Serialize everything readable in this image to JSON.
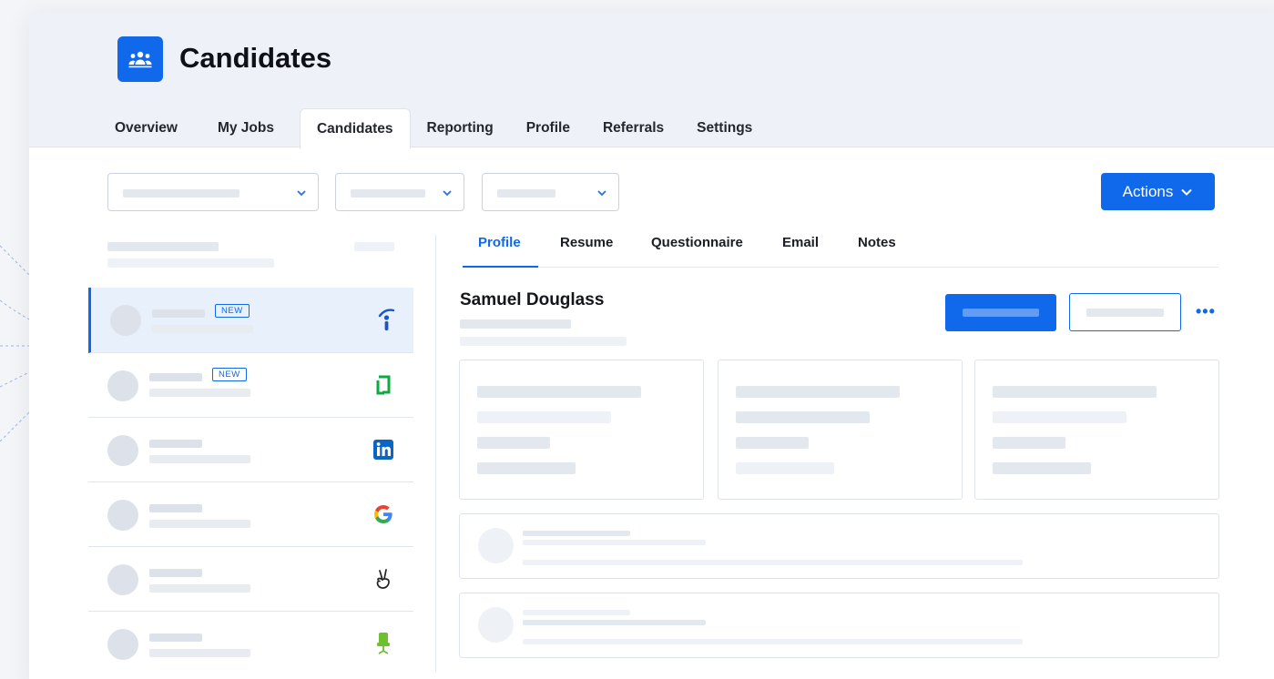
{
  "app": {
    "title": "Candidates",
    "accent_color": "#1068eb",
    "icon": "people-group-icon"
  },
  "nav": {
    "tabs": [
      {
        "label": "Overview",
        "active": false
      },
      {
        "label": "My Jobs",
        "active": false
      },
      {
        "label": "Candidates",
        "active": true
      },
      {
        "label": "Reporting",
        "active": false
      },
      {
        "label": "Profile",
        "active": false
      },
      {
        "label": "Referrals",
        "active": false
      },
      {
        "label": "Settings",
        "active": false
      }
    ]
  },
  "toolbar": {
    "actions_label": "Actions",
    "filters": [
      {
        "icon": "chevron-down-icon"
      },
      {
        "icon": "chevron-down-icon"
      },
      {
        "icon": "chevron-down-icon"
      }
    ]
  },
  "candidate_list": {
    "rows": [
      {
        "badge": "NEW",
        "source_icon": "indeed-icon",
        "selected": true
      },
      {
        "badge": "NEW",
        "source_icon": "glassdoor-icon",
        "selected": false
      },
      {
        "badge": "",
        "source_icon": "linkedin-icon",
        "selected": false
      },
      {
        "badge": "",
        "source_icon": "google-icon",
        "selected": false
      },
      {
        "badge": "",
        "source_icon": "angellist-icon",
        "selected": false
      },
      {
        "badge": "",
        "source_icon": "ziprecruiter-icon",
        "selected": false
      }
    ]
  },
  "profile": {
    "tabs": [
      {
        "label": "Profile",
        "active": true
      },
      {
        "label": "Resume",
        "active": false
      },
      {
        "label": "Questionnaire",
        "active": false
      },
      {
        "label": "Email",
        "active": false
      },
      {
        "label": "Notes",
        "active": false
      }
    ],
    "candidate_name": "Samuel Douglass",
    "more_label": "•••"
  }
}
